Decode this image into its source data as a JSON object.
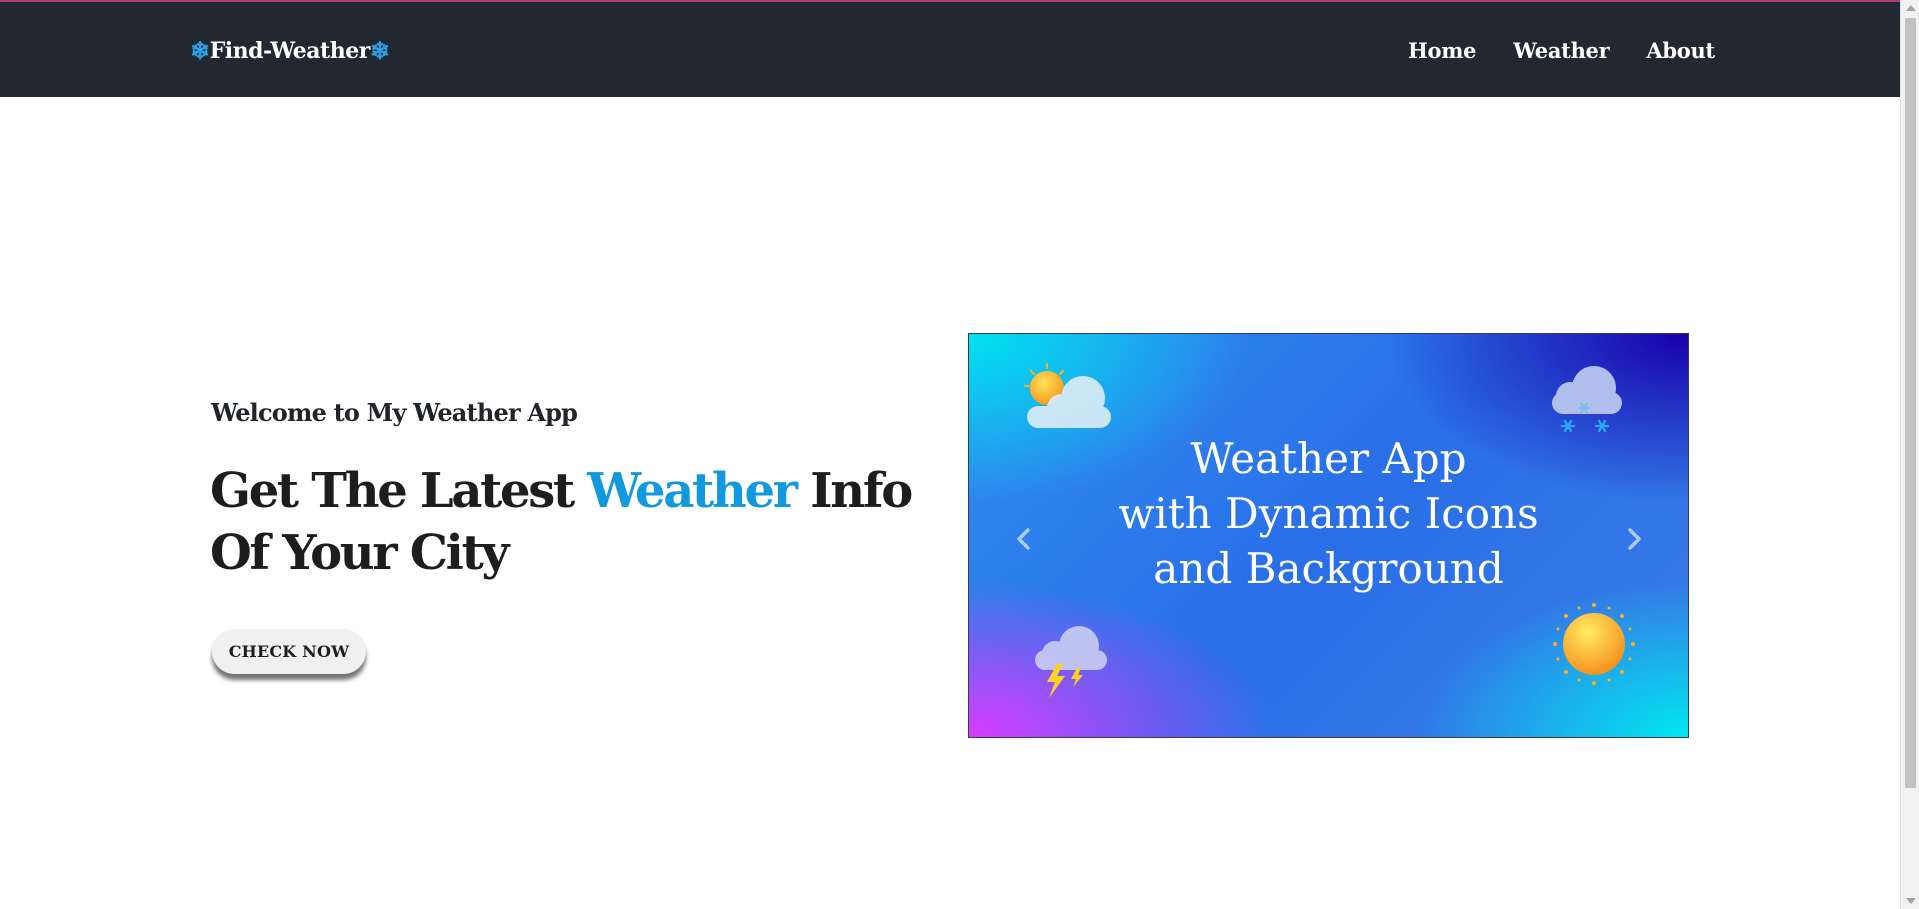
{
  "navbar": {
    "brand_prefix_icon": "snowflake-icon",
    "brand": "Find-Weather",
    "brand_suffix_icon": "snowflake-icon",
    "links": [
      "Home",
      "Weather",
      "About"
    ]
  },
  "hero": {
    "welcome": "Welcome to My Weather App",
    "headline_part1": "Get The Latest",
    "headline_accent": "Weather",
    "headline_part2": "Info Of Your City",
    "cta": "CHECK NOW"
  },
  "carousel": {
    "caption_lines": [
      "Weather App",
      "with Dynamic Icons",
      "and Background"
    ],
    "icons": [
      "partly-cloudy-icon",
      "snow-cloud-icon",
      "thunderstorm-icon",
      "sun-icon"
    ],
    "prev_icon": "chevron-left-icon",
    "next_icon": "chevron-right-icon"
  },
  "colors": {
    "navbar_bg": "#212830",
    "accent": "#1199e0",
    "brand_icon": "#2ba0e8",
    "button_bg": "#f0f0f0"
  }
}
